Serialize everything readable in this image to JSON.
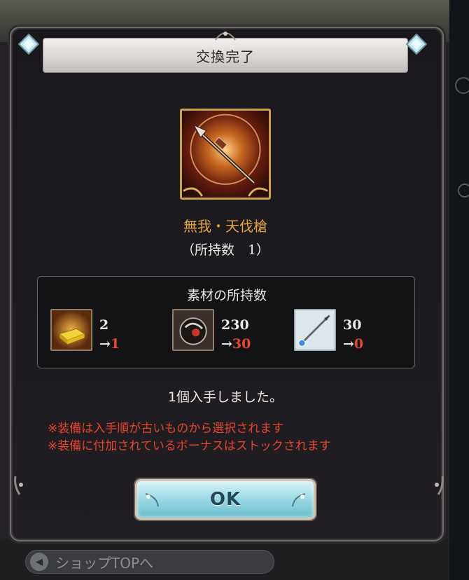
{
  "background": {
    "back_button_label": "ショップTOPへ"
  },
  "modal": {
    "title": "交換完了",
    "item": {
      "icon": "spear-weapon-icon",
      "name": "無我・天伐槍",
      "owned_text": "（所持数　1）"
    },
    "materials": {
      "title": "素材の所持数",
      "items": [
        {
          "icon": "gold-brick-icon",
          "before": "2",
          "after_prefix": "→",
          "after": "1"
        },
        {
          "icon": "dark-orb-icon",
          "before": "230",
          "after_prefix": "→",
          "after": "30"
        },
        {
          "icon": "silver-spear-icon",
          "before": "30",
          "after_prefix": "→",
          "after": "0"
        }
      ]
    },
    "obtained_text": "1個入手しました。",
    "notes": [
      "※装備は入手順が古いものから選択されます",
      "※装備に付加されているボーナスはストックされます"
    ],
    "ok_label": "OK"
  },
  "colors": {
    "item_name": "#e1a23a",
    "after_value": "#e4482e",
    "notes": "#e4442c",
    "ok_button": "#9fdbe6"
  }
}
